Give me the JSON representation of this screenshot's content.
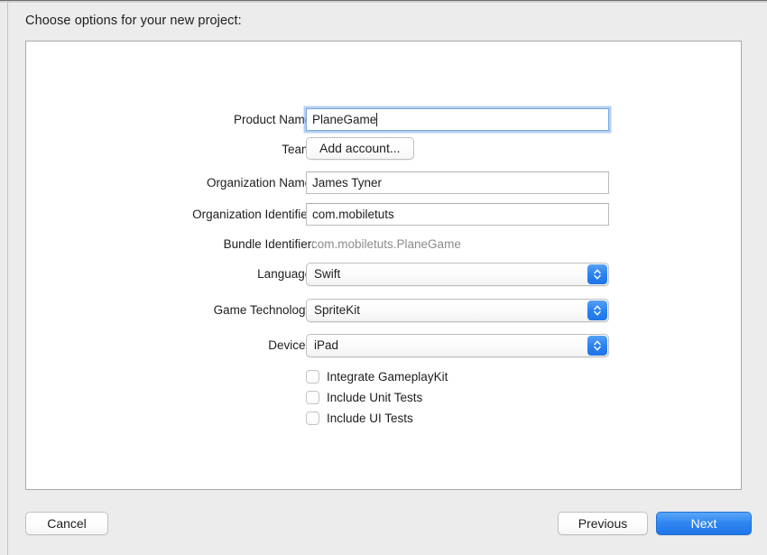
{
  "dialog": {
    "title": "Choose options for your new project:"
  },
  "form": {
    "rows": [
      {
        "label": "Product Name:",
        "type": "textfield",
        "value": "PlaneGame",
        "focused": true
      },
      {
        "label": "Team:",
        "type": "button",
        "value": "Add account..."
      },
      {
        "label": "Organization Name:",
        "type": "textfield",
        "value": "James Tyner",
        "focused": false
      },
      {
        "label": "Organization Identifier:",
        "type": "textfield",
        "value": "com.mobiletuts",
        "focused": false
      },
      {
        "label": "Bundle Identifier:",
        "type": "static",
        "value": "com.mobiletuts.PlaneGame"
      },
      {
        "label": "Language:",
        "type": "popup",
        "value": "Swift"
      },
      {
        "label": "Game Technology:",
        "type": "popup",
        "value": "SpriteKit"
      },
      {
        "label": "Devices:",
        "type": "popup",
        "value": "iPad"
      }
    ],
    "checkboxes": [
      {
        "label": "Integrate GameplayKit",
        "checked": false
      },
      {
        "label": "Include Unit Tests",
        "checked": false
      },
      {
        "label": "Include UI Tests",
        "checked": false
      }
    ]
  },
  "footer": {
    "cancel_label": "Cancel",
    "previous_label": "Previous",
    "next_label": "Next"
  },
  "colors": {
    "accent_blue": "#2f86f0",
    "focus_ring": "#7aaae8",
    "window_bg": "#ececec",
    "panel_bg": "#ffffff",
    "disabled_text": "#8c8c8c"
  }
}
